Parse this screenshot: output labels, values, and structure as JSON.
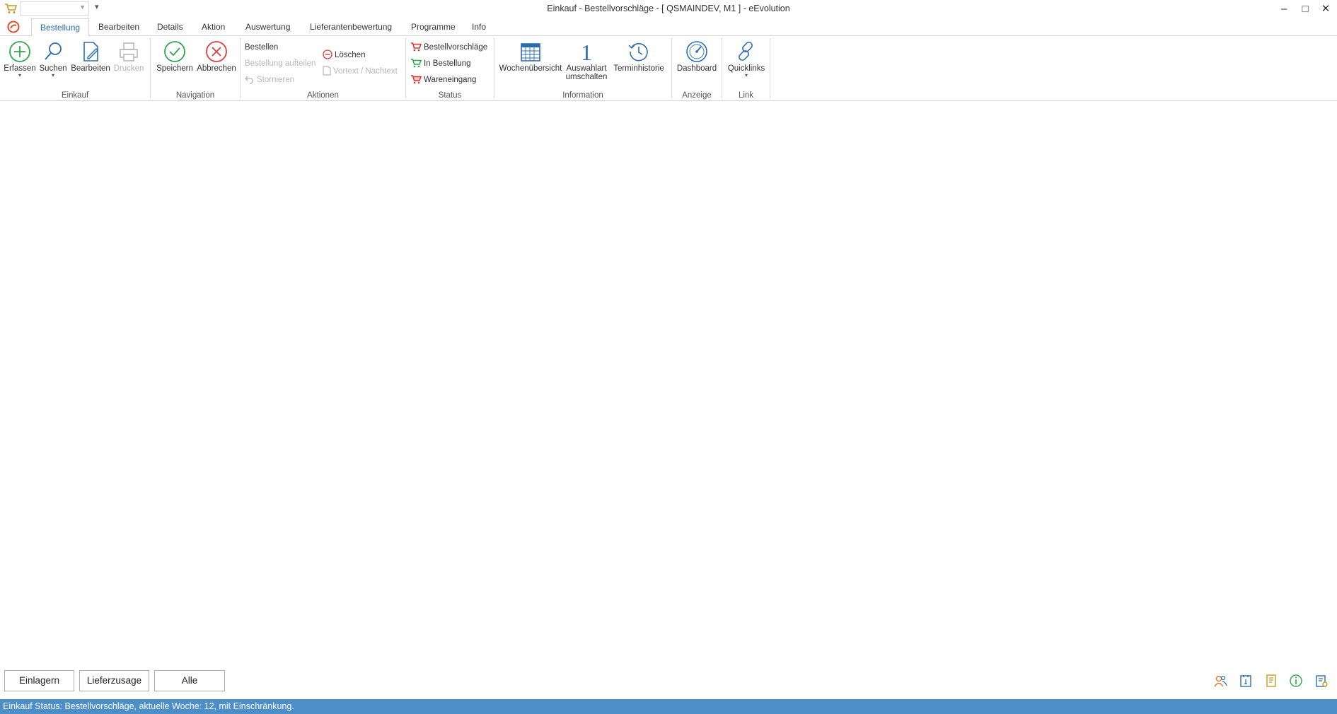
{
  "window": {
    "title": "Einkauf - Bestellvorschläge - [ QSMAINDEV, M1 ]  -  eEvolution",
    "controls": {
      "minimize": "–",
      "maximize": "□",
      "close": "✕"
    },
    "qa_more": "▾"
  },
  "tabs": [
    "Bestellung",
    "Bearbeiten",
    "Details",
    "Aktion",
    "Auswertung",
    "Lieferantenbewertung",
    "Programme",
    "Info"
  ],
  "ribbon": {
    "einkauf": {
      "label": "Einkauf",
      "erfassen": "Erfassen",
      "suchen": "Suchen",
      "bearbeiten": "Bearbeiten",
      "drucken": "Drucken"
    },
    "navigation": {
      "label": "Navigation",
      "speichern": "Speichern",
      "abbrechen": "Abbrechen"
    },
    "aktionen": {
      "label": "Aktionen",
      "bestellen": "Bestellen",
      "aufteilen": "Bestellung aufteilen",
      "stornieren": "Stornieren",
      "loeschen": "Löschen",
      "vortext": "Vortext / Nachtext"
    },
    "status": {
      "label": "Status",
      "bestellvorschlaege": "Bestellvorschläge",
      "in_bestellung": "In Bestellung",
      "wareneingang": "Wareneingang"
    },
    "information": {
      "label": "Information",
      "wochen": "Wochenübersicht",
      "auswahl1": "Auswahlart",
      "auswahl2": "umschalten",
      "termin": "Terminhistorie",
      "auswahl_icon_text": "1"
    },
    "anzeige": {
      "label": "Anzeige",
      "dashboard": "Dashboard"
    },
    "link": {
      "label": "Link",
      "quicklinks": "Quicklinks"
    },
    "dropdown_glyph": "▾"
  },
  "bottom_buttons": {
    "einlagern": "Einlagern",
    "lieferzusage": "Lieferzusage",
    "alle": "Alle"
  },
  "status_bar": {
    "text": "Einkauf Status: Bestellvorschläge, aktuelle Woche: 12, mit Einschränkung."
  },
  "colors": {
    "accent": "#2b6cb3",
    "green": "#2ea84a",
    "red": "#e03c3c",
    "status_bar": "#4d8ec9",
    "cart_red": "#d9342b",
    "orange": "#e07a2e"
  }
}
